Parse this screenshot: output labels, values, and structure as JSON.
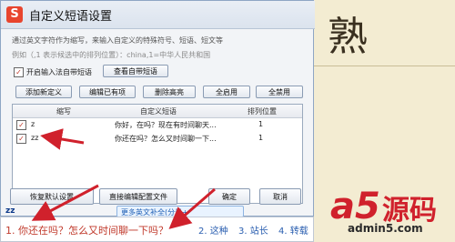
{
  "window": {
    "title": "自定义短语设置",
    "logo_text": "S"
  },
  "description": "通过英文字符作为缩写，来输入自定义的特殊符号、短语、短文等",
  "example": "例如（,1 表示候选中的排列位置）：china,1=中华人民共和国",
  "options": {
    "enable_builtin_label": "开启输入法自带短语",
    "enable_builtin_checked": true,
    "view_builtin_button": "查看自带短语"
  },
  "toolbar": {
    "add_label": "添加新定义",
    "edit_label": "编辑已有项",
    "delete_label": "删除高亮",
    "enable_all_label": "全启用",
    "disable_all_label": "全禁用"
  },
  "table": {
    "headers": [
      "缩写",
      "自定义短语",
      "排列位置"
    ],
    "rows": [
      {
        "checked": true,
        "abbr": "z",
        "phrase": "你好，在吗？现在有时间聊天...",
        "pos": "1"
      },
      {
        "checked": true,
        "abbr": "zz",
        "phrase": "你还在吗？怎么又时间聊一下...",
        "pos": "1"
      }
    ]
  },
  "footer": {
    "restore_label": "恢复默认设置",
    "edit_file_label": "直接编辑配置文件",
    "ok_label": "确定",
    "cancel_label": "取消"
  },
  "ime": {
    "input": "zz",
    "more_label": "更多英文补全(分号+",
    "candidates": [
      "1. 你还在吗？怎么又时间聊一下吗？",
      "2. 这种",
      "3. 站长",
      "4. 转载"
    ]
  },
  "background": {
    "char": "熟"
  },
  "watermark": {
    "brand_a5": "a5",
    "brand_cn": "源码",
    "site": "admin5.com"
  },
  "colors": {
    "arrow": "#d0212c",
    "candidate": "#c0392b",
    "brand": "#d0212c"
  }
}
